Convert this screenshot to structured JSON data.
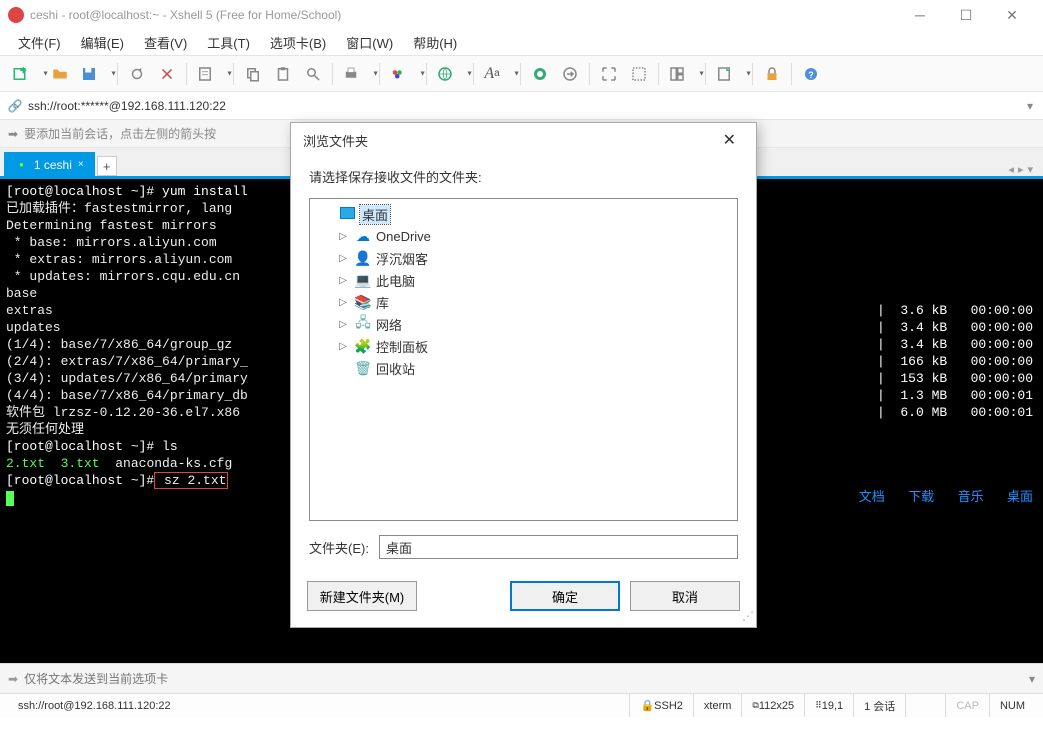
{
  "window": {
    "title": "ceshi - root@localhost:~ - Xshell 5 (Free for Home/School)"
  },
  "menu": {
    "file": "文件(F)",
    "edit": "编辑(E)",
    "view": "查看(V)",
    "tools": "工具(T)",
    "tabs": "选项卡(B)",
    "window": "窗口(W)",
    "help": "帮助(H)"
  },
  "address": {
    "text": "ssh://root:******@192.168.111.120:22"
  },
  "hint": {
    "text": "要添加当前会话，点击左侧的箭头按"
  },
  "tabs": {
    "t1": "1 ceshi",
    "add": "+"
  },
  "terminal": {
    "l1a": "[root@localhost ~]#",
    "l1b": " yum install",
    "l2": "已加载插件：fastestmirror, lang",
    "l3": "Determining fastest mirrors",
    "l4": " * base: mirrors.aliyun.com",
    "l5": " * extras: mirrors.aliyun.com",
    "l6": " * updates: mirrors.cqu.edu.cn",
    "l7": "base",
    "l8": "extras",
    "l9": "updates",
    "l10": "(1/4): base/7/x86_64/group_gz",
    "l11": "(2/4): extras/7/x86_64/primary_",
    "l12": "(3/4): updates/7/x86_64/primary",
    "l13": "(4/4): base/7/x86_64/primary_db",
    "l14": "软件包 lrzsz-0.12.20-36.el7.x86",
    "l15": "无须任何处理",
    "l16a": "[root@localhost ~]#",
    "l16b": " ls",
    "l17a": "2.txt",
    "l17b": "3.txt",
    "l17c": "anaconda-ks.cfg",
    "l18a": "[root@localhost ~]#",
    "l18b": " sz 2.txt",
    "r7": "|  3.6 kB   00:00:00",
    "r8": "|  3.4 kB   00:00:00",
    "r9": "|  3.4 kB   00:00:00",
    "r10": "|  166 kB   00:00:00",
    "r11": "|  153 kB   00:00:00",
    "r12": "|  1.3 MB   00:00:01",
    "r13": "|  6.0 MB   00:00:01",
    "links1": "文档",
    "links2": "下载",
    "links3": "音乐",
    "links4": "桌面"
  },
  "input": {
    "placeholder": "仅将文本发送到当前选项卡"
  },
  "status": {
    "conn": "ssh://root@192.168.111.120:22",
    "s1": "SSH2",
    "s2": "xterm",
    "s3": "112x25",
    "s4": "19,1",
    "s5": "1 会话",
    "cap": "CAP",
    "num": "NUM"
  },
  "dialog": {
    "title": "浏览文件夹",
    "msg": "请选择保存接收文件的文件夹:",
    "tree": {
      "desktop": "桌面",
      "onedrive": "OneDrive",
      "user": "浮沉烟客",
      "pc": "此电脑",
      "lib": "库",
      "net": "网络",
      "ctrl": "控制面板",
      "recycle": "回收站"
    },
    "folder_label": "文件夹(E):",
    "folder_value": "桌面",
    "btn_new": "新建文件夹(M)",
    "btn_ok": "确定",
    "btn_cancel": "取消"
  }
}
